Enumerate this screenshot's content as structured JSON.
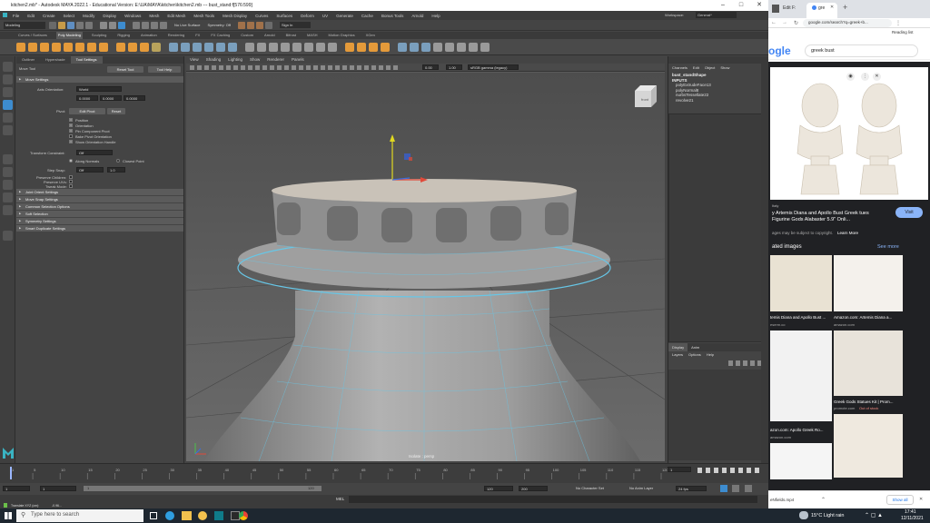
{
  "maya": {
    "title": "kitchen2.mb* - Autodesk MAYA 2022.1 - Educational Version: E:\\UA\\MAYA\\kitchen\\kitchen2.mb --- bust_stand:f[576:599]",
    "menus": [
      "File",
      "Edit",
      "Create",
      "Select",
      "Modify",
      "Display",
      "Windows",
      "Mesh",
      "Edit Mesh",
      "Mesh Tools",
      "Mesh Display",
      "Curves",
      "Surfaces",
      "Deform",
      "UV",
      "Generate",
      "Cache",
      "Bonus Tools",
      "Arnold",
      "Help"
    ],
    "workspace_label": "Workspace:",
    "workspace_value": "General*",
    "mode": "Modeling",
    "no_live": "No Live Surface",
    "symmetry": "Symmetry: Off",
    "sign_in": "Sign In",
    "shelf_tabs": [
      "Curves / Surfaces",
      "Poly Modeling",
      "Sculpting",
      "Rigging",
      "Animation",
      "Rendering",
      "FX",
      "FX Caching",
      "Custom",
      "Arnold",
      "Bifrost",
      "MASH",
      "Motion Graphics",
      "XGen"
    ],
    "active_shelf": "Poly Modeling",
    "panel_tabs": [
      "Outliner",
      "Hypershade",
      "Tool Settings"
    ],
    "move_tool": "Move Tool",
    "reset_tool": "Reset Tool",
    "tool_help": "Tool Help",
    "move_settings": "Move Settings",
    "axis_orientation_label": "Axis Orientation:",
    "axis_orientation_value": "World",
    "axis_values": [
      "0.0000",
      "0.0000",
      "0.0000"
    ],
    "pivot_label": "Pivot:",
    "edit_pivot": "Edit Pivot",
    "reset": "Reset",
    "checkboxes": [
      "Position",
      "Orientation",
      "Pin Component Pivot",
      "Bake Pivot Orientation",
      "Show Orientation Handle"
    ],
    "transform_constraint_label": "Transform Constraint:",
    "transform_constraint_value": "Off",
    "along_normals": "Along Normals",
    "closest_point": "Closest Point",
    "step_snap_label": "Step Snap:",
    "step_snap_value": "Off",
    "step_snap_num": "1.0",
    "preserve_children": "Preserve Children:",
    "preserve_uvs": "Preserve UVs:",
    "tweak_mode": "Tweak Mode:",
    "sections": [
      "Joint Orient Settings",
      "Move Snap Settings",
      "Common Selection Options",
      "Soft Selection",
      "Symmetry Settings",
      "Smart Duplicate Settings"
    ],
    "viewport_menu": [
      "View",
      "Shading",
      "Lighting",
      "Show",
      "Renderer",
      "Panels"
    ],
    "viewport_fields": [
      "0.00",
      "1.00"
    ],
    "color_space": "sRGB gamma (legacy)",
    "camera_label": "front",
    "persp_label": "Isolate : persp",
    "channel_menu": [
      "Channels",
      "Edit",
      "Object",
      "Show"
    ],
    "channel_items": [
      "bust_standShape",
      "INPUTS",
      "polyExtrudeFace13",
      "polyNormal8",
      "nurbsTessellate22",
      "revolve21"
    ],
    "layer_tabs": [
      "Display",
      "Anim"
    ],
    "layer_menu": [
      "Layers",
      "Options",
      "Help"
    ],
    "timeline_ticks": [
      "1",
      "5",
      "10",
      "15",
      "20",
      "25",
      "30",
      "35",
      "40",
      "45",
      "50",
      "55",
      "60",
      "65",
      "70",
      "75",
      "80",
      "85",
      "90",
      "95",
      "100",
      "105",
      "110",
      "115",
      "120"
    ],
    "current_frame": "1",
    "range_start": "1",
    "range_start2": "1",
    "range_slider_end": "120",
    "range_end": "120",
    "range_end2": "200",
    "no_character_set": "No Character Set",
    "no_anim_layer": "No Anim Layer",
    "fps": "24 fps",
    "mel": "MEL",
    "help_line": "Translate XYZ (cm):",
    "help_value": "-0.96..."
  },
  "browser": {
    "tab1": "Edit F:",
    "tab2": "gre",
    "url": "google.com/search?q=greek+b...",
    "reading_list": "Reading list",
    "search_query": "greek bust",
    "logo_fragment": "ogle",
    "source": "Italy",
    "product_title": "y Artemis Diana and Apollo Bust Greek tues Figurine Gods Alabaster 5.9\" Onli...",
    "visit": "Visit",
    "copyright_note": "ages may be subject to copyright.",
    "learn_more": "Learn More",
    "related_images": "ated images",
    "see_more": "See more",
    "related": [
      {
        "caption": "temis Diana and Apollo Bust ...",
        "site": "eserm.co"
      },
      {
        "caption": "Amazon.com: Artemis Diana a...",
        "site": "amazon.com"
      },
      {
        "caption": "azon.com: Apollo Greek Ro...",
        "site": "amazon.com"
      },
      {
        "caption": "Greek Gods Statues Kit | Prom...",
        "site": "promote.com",
        "stock": "Out of stock"
      }
    ],
    "download": "eNfields.mp4",
    "show_all": "Show all"
  },
  "taskbar": {
    "search_placeholder": "Type here to search",
    "weather": "15°C  Light rain",
    "time": "17:41",
    "date": "12/11/2021"
  },
  "colors": {
    "maya_bg": "#444444",
    "viewport_bg": "#5a5a5a",
    "accent_blue": "#3d8ccf",
    "google_blue": "#1a73e8"
  }
}
